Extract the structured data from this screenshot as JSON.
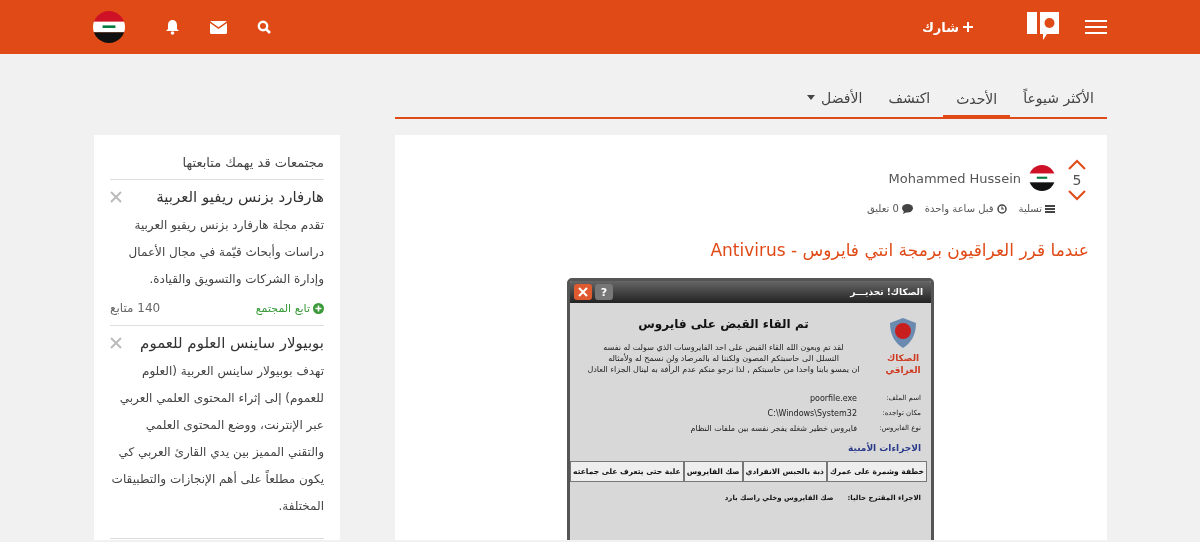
{
  "header": {
    "share_label": "شارك"
  },
  "tabs": [
    {
      "label": "الأكثر شيوعاً",
      "selected": false,
      "kind": "link"
    },
    {
      "label": "الأحدث",
      "selected": true,
      "kind": "link"
    },
    {
      "label": "اكتشف",
      "selected": false,
      "kind": "link"
    },
    {
      "label": "الأفضل",
      "selected": false,
      "kind": "dropdown"
    }
  ],
  "post": {
    "votes": "5",
    "author": "Mohammed Hussein",
    "category": "تسلية",
    "time": "قبل ساعة واحدة",
    "comments": "0 تعليق",
    "title": "عندما قرر العراقيون برمجة انتي فايروس - Antivirus",
    "image": {
      "title": "الصكاك! تحذيـــر",
      "help_button": "?",
      "heading": "تم القاء القبض على فايروس",
      "message_lines": [
        "لقد تم وبعون الله القاء القبض على احد الفايروسات الذي سولت له نفسه",
        "التسلل الى حاسبتكم المصون ولكننا له بالمرصاد ولن نسمح له ولأمثاله",
        "ان يمسو بابنا واحدا من حاسبتكم , لذا نرجو منكم عدم الرأفة به لينال الجزاء العادل"
      ],
      "brand_lines": [
        "الصكاك",
        "العراقي"
      ],
      "fields": [
        {
          "label": "اسم الملف:",
          "value": "poorfile.exe"
        },
        {
          "label": "مكان تواجده:",
          "value": "C:\\Windows\\System32"
        },
        {
          "label": "نوع الفايروس:",
          "value": "فايروس خطير شغله يفجر نفسه بين ملفات النظام"
        }
      ],
      "section": "الاجراءات الأمنية",
      "buttons": [
        "خطفة وشمرة على عمرك",
        "ذبة بالحبس الانفرادي",
        "صك الفايروس",
        "علبة حتى يتعرف على جماعته"
      ],
      "suggested": {
        "label": "الاجراء المقترح حاليا:",
        "value": "صك الفايروس وخلي راسك بارد"
      }
    }
  },
  "sidebar": {
    "heading": "مجتمعات قد يهمك متابعتها",
    "communities": [
      {
        "name": "هارفارد بزنس ريفيو العربية",
        "description": "تقدم مجلة هارفارد بزنس ريفيو العربية دراسات وأبحاث قيّمة في مجال الأعمال وإدارة الشركات والتسويق والقيادة.",
        "follow_label": "تابع المجتمع",
        "followers": "140 متابع"
      },
      {
        "name": "بوبيولار ساينس العلوم للعموم",
        "description": "تهدف بوبيولار ساينس العربية (العلوم للعموم) إلى إثراء المحتوى العلمي العربي عبر الإنترنت، ووضع المحتوى العلمي والتقني المميز بين يدي القارئ العربي كي يكون مطلعاً على أهم الإنجازات والتطبيقات المختلفة."
      }
    ]
  }
}
